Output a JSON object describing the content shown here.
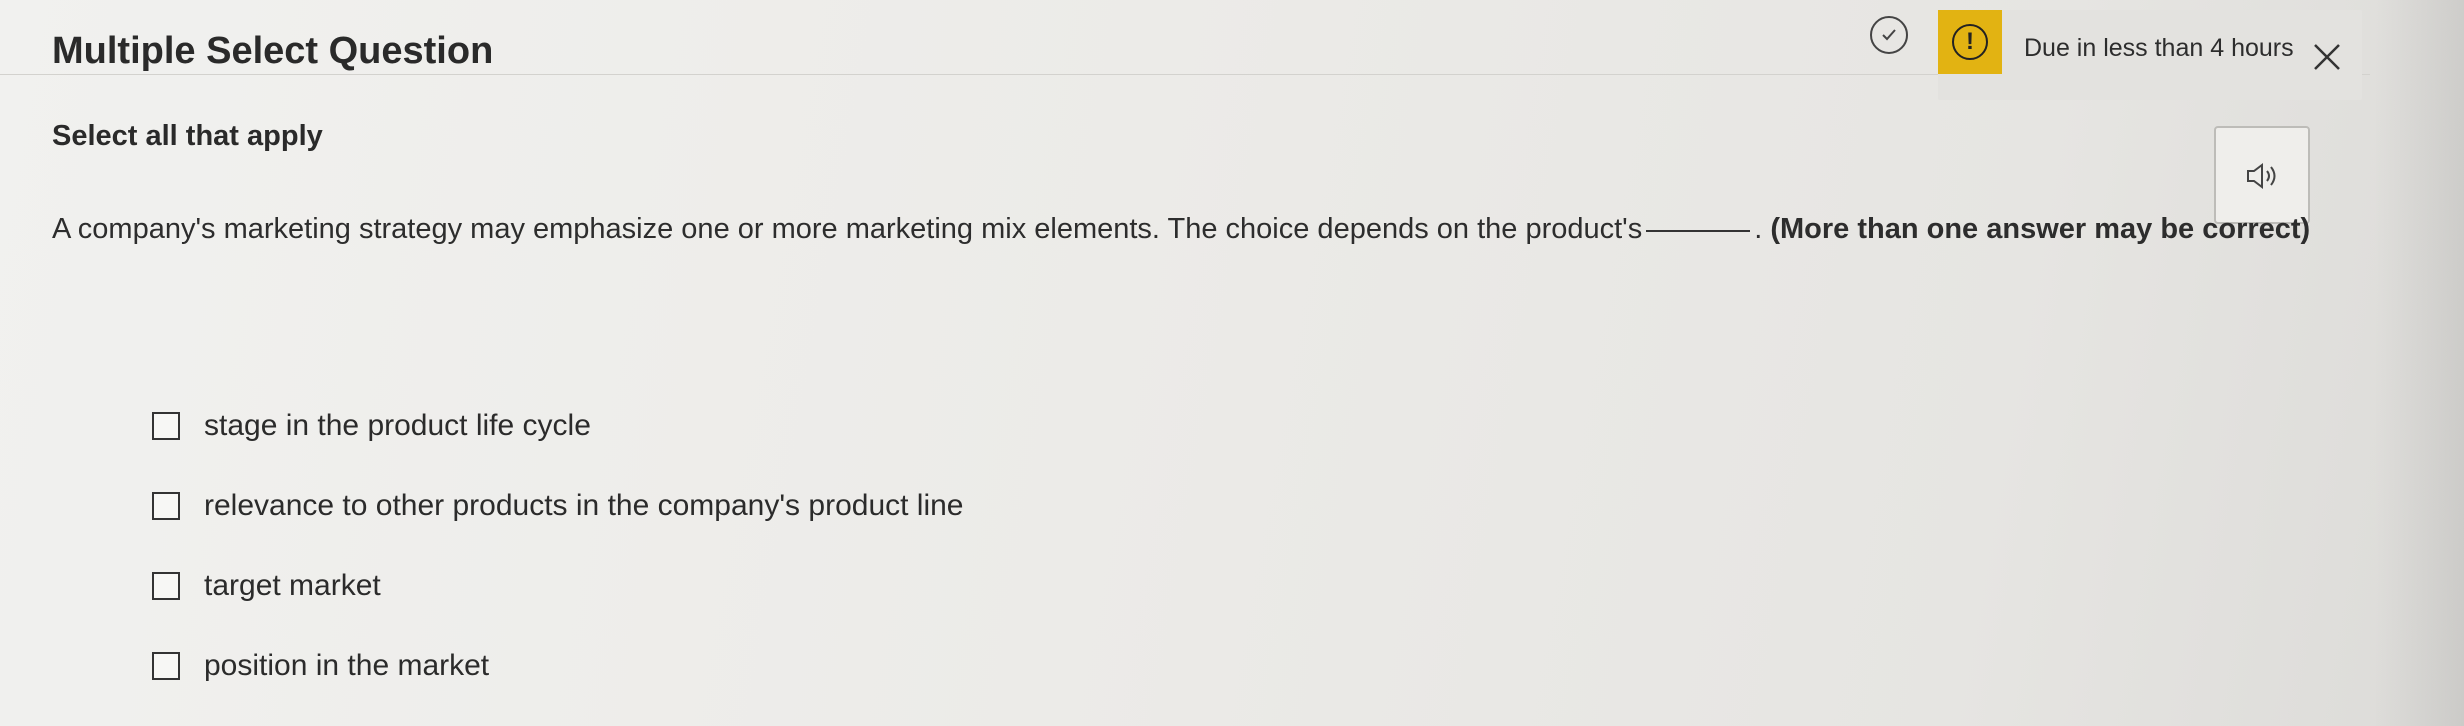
{
  "header": {
    "title": "Multiple Select Question",
    "due_text": "Due in less than 4 hours",
    "warning_glyph": "!",
    "warning_color": "#e2b312"
  },
  "instructions": "Select all that apply",
  "question": {
    "text_before": "A company's marketing strategy may emphasize one or more marketing mix elements. The choice depends on the product's",
    "text_after": ".",
    "note": "(More than one answer may be correct)"
  },
  "options": [
    {
      "label": "stage in the product life cycle",
      "checked": false
    },
    {
      "label": "relevance to other products in the company's product line",
      "checked": false
    },
    {
      "label": "target market",
      "checked": false
    },
    {
      "label": "position in the market",
      "checked": false
    }
  ],
  "icons": {
    "status": "check-circle-icon",
    "warning": "exclamation-circle-icon",
    "close": "close-icon",
    "audio": "speaker-icon"
  }
}
